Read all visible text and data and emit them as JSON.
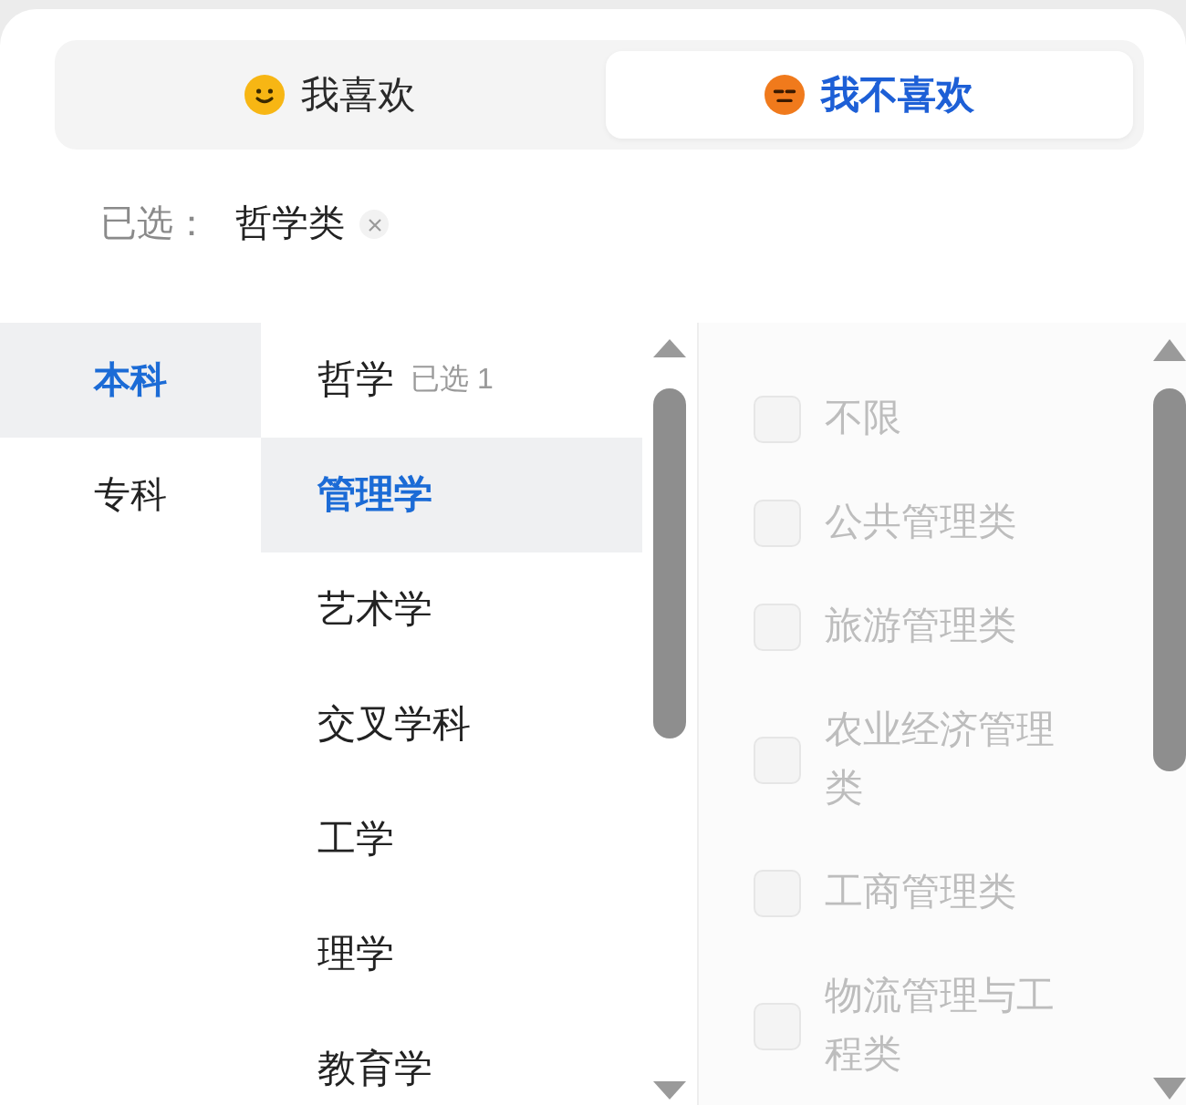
{
  "tabs": [
    {
      "label": "我喜欢",
      "selected": false,
      "kind": "like"
    },
    {
      "label": "我不喜欢",
      "selected": true,
      "kind": "dislike"
    }
  ],
  "selection": {
    "label": "已选：",
    "tags": [
      {
        "label": "哲学类"
      }
    ]
  },
  "levels": [
    {
      "label": "本科",
      "selected": true
    },
    {
      "label": "专科",
      "selected": false
    }
  ],
  "disciplines": [
    {
      "label": "哲学",
      "selected": false,
      "note": "已选 1"
    },
    {
      "label": "管理学",
      "selected": true
    },
    {
      "label": "艺术学",
      "selected": false
    },
    {
      "label": "交叉学科",
      "selected": false
    },
    {
      "label": "工学",
      "selected": false
    },
    {
      "label": "理学",
      "selected": false
    },
    {
      "label": "教育学",
      "selected": false
    }
  ],
  "majors": [
    {
      "label": "不限",
      "checked": false,
      "disabled": true
    },
    {
      "label": "公共管理类",
      "checked": false,
      "disabled": true
    },
    {
      "label": "旅游管理类",
      "checked": false,
      "disabled": true
    },
    {
      "label": "农业经济管理类",
      "checked": false,
      "disabled": true
    },
    {
      "label": "工商管理类",
      "checked": false,
      "disabled": true
    },
    {
      "label": "物流管理与工程类",
      "checked": false,
      "disabled": true
    }
  ]
}
